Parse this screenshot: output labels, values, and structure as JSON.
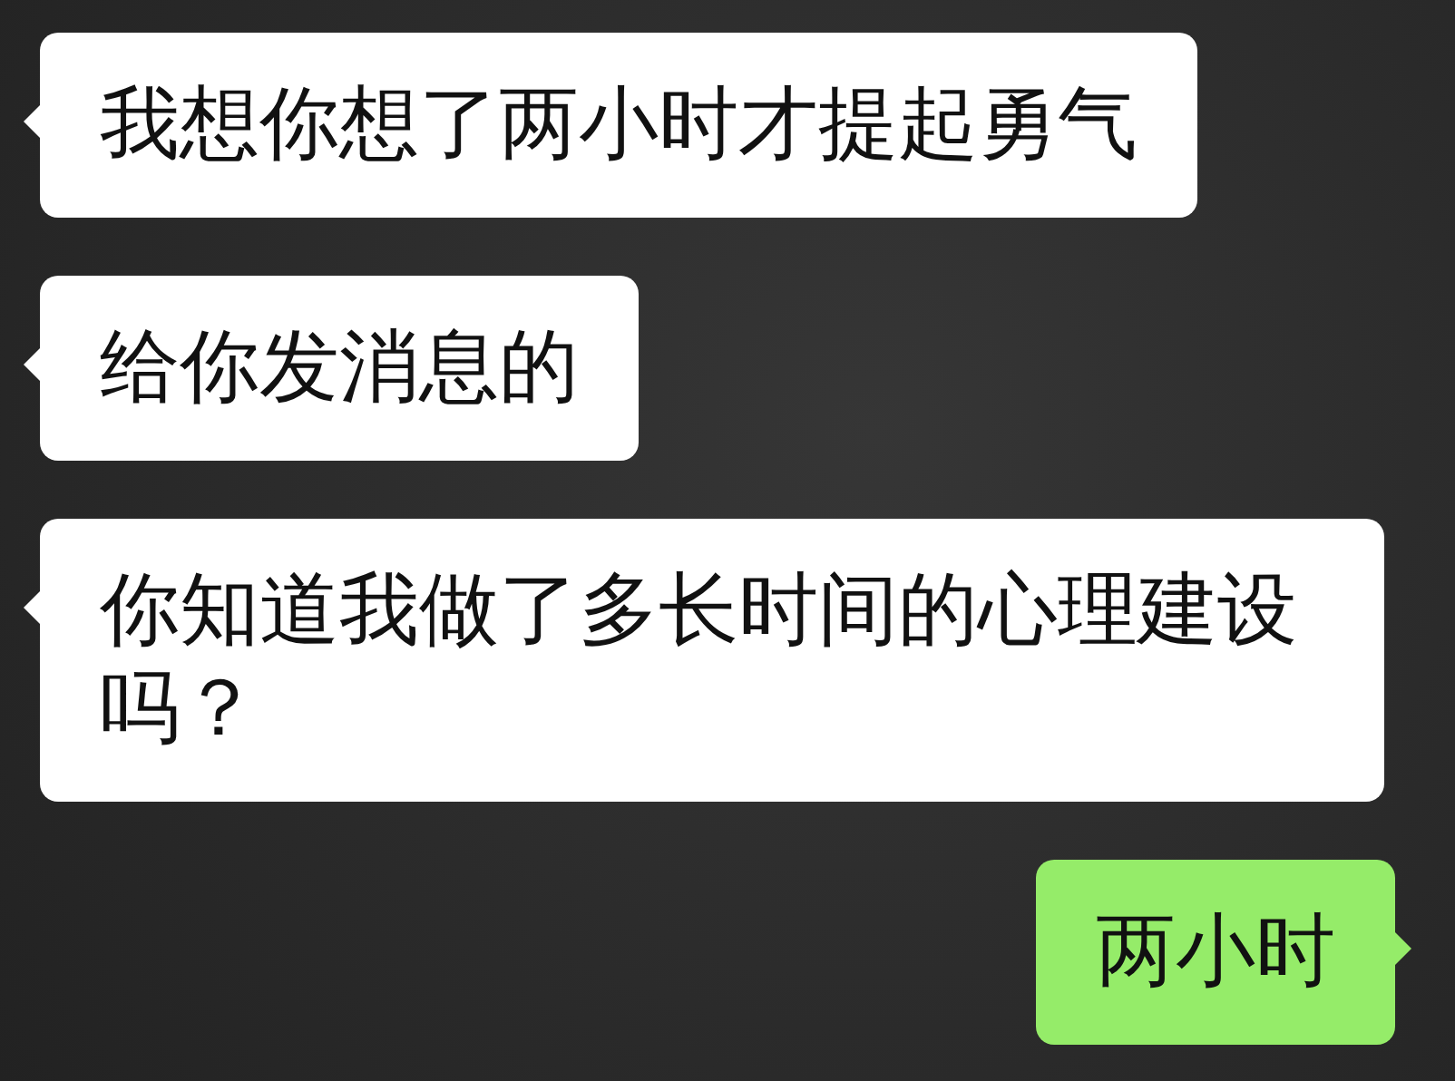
{
  "messages": [
    {
      "kind": "received",
      "text": "我想你想了两小时才提起勇气"
    },
    {
      "kind": "received",
      "text": "给你发消息的"
    },
    {
      "kind": "received",
      "text": "你知道我做了多长时间的心理建设吗？"
    },
    {
      "kind": "sent",
      "text": "两小时"
    }
  ]
}
